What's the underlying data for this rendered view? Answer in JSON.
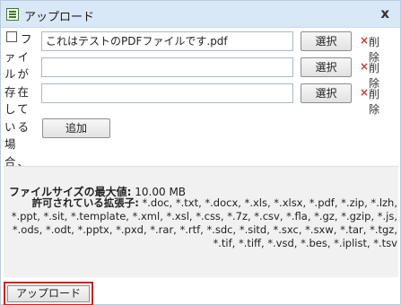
{
  "dialog": {
    "title": "アップロード",
    "close_label": "x"
  },
  "overwrite": {
    "label": "ファイルが存在している場合、上書きしますか?",
    "checked": false
  },
  "files": [
    {
      "value": "これはテストのPDFファイルです.pdf",
      "browse_label": "選択",
      "delete_label": "削除"
    },
    {
      "value": "",
      "browse_label": "選択",
      "delete_label": "削除"
    },
    {
      "value": "",
      "browse_label": "選択",
      "delete_label": "削除"
    }
  ],
  "add_label": "追加",
  "limits": {
    "max_size_label": "ファイルサイズの最大値:",
    "max_size_value": "10.00 MB",
    "extensions_label": "許可されている拡張子:",
    "extensions_value": "*.doc, *.txt, *.docx, *.xls, *.xlsx, *.pdf, *.zip, *.lzh, *.ppt, *.sit, *.template, *.xml, *.xsl, *.css, *.7z, *.csv, *.fla, *.gz, *.gzip, *.js, *.ods, *.odt, *.pptx, *.pxd, *.rar, *.rtf, *.sdc, *.sitd, *.sxc, *.sxw, *.tar, *.tgz, *.tif, *.tiff, *.vsd, *.bes, *.iplist, *.tsv"
  },
  "upload_label": "アップロード",
  "colors": {
    "titlebar": "#d9e8f7",
    "delete_x": "#d03b2c",
    "highlight": "#d81e1e"
  }
}
